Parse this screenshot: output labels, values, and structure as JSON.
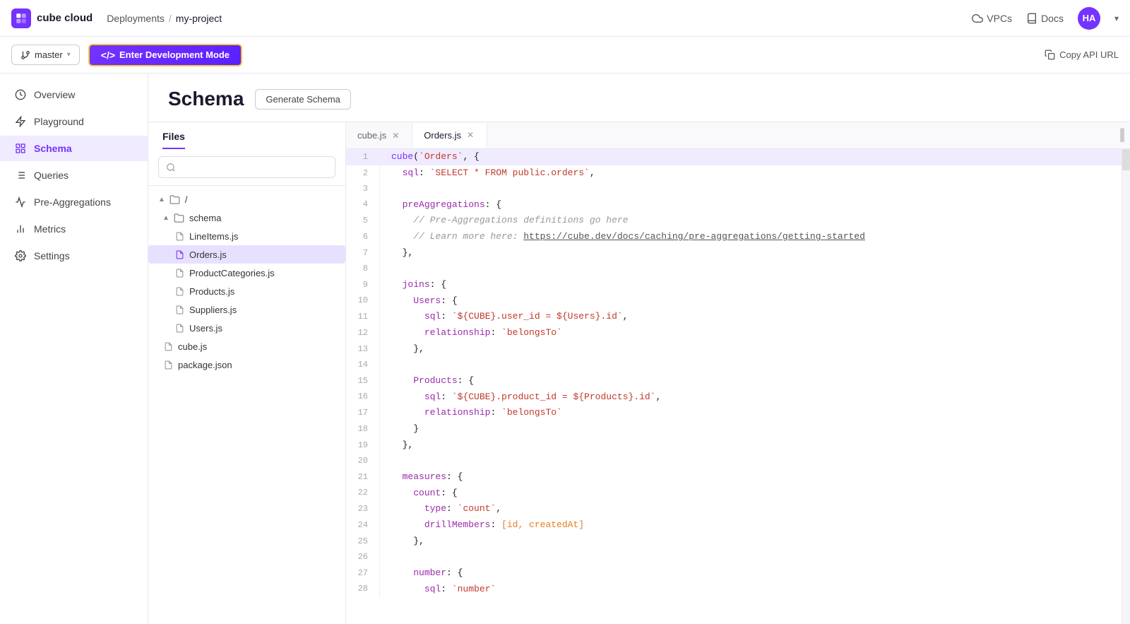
{
  "app": {
    "logo_text": "cube cloud",
    "breadcrumb_root": "Deployments",
    "breadcrumb_sep": "/",
    "breadcrumb_current": "my-project"
  },
  "topnav": {
    "vpcs_label": "VPCs",
    "docs_label": "Docs",
    "avatar_initials": "HA",
    "avatar_chevron": "▾"
  },
  "toolbar": {
    "branch_label": "master",
    "branch_chevron": "▾",
    "dev_mode_label": "Enter Development Mode",
    "copy_api_label": "Copy API URL"
  },
  "sidebar": {
    "items": [
      {
        "id": "overview",
        "label": "Overview"
      },
      {
        "id": "playground",
        "label": "Playground"
      },
      {
        "id": "schema",
        "label": "Schema"
      },
      {
        "id": "queries",
        "label": "Queries"
      },
      {
        "id": "pre-aggregations",
        "label": "Pre-Aggregations"
      },
      {
        "id": "metrics",
        "label": "Metrics"
      },
      {
        "id": "settings",
        "label": "Settings"
      }
    ]
  },
  "content": {
    "page_title": "Schema",
    "generate_schema_btn": "Generate Schema"
  },
  "files_panel": {
    "tab_label": "Files",
    "search_placeholder": "",
    "tree": [
      {
        "id": "root",
        "label": "/",
        "type": "folder",
        "indent": 0,
        "expanded": true,
        "arrow": "▲"
      },
      {
        "id": "schema-folder",
        "label": "schema",
        "type": "folder",
        "indent": 1,
        "expanded": true,
        "arrow": "▲"
      },
      {
        "id": "lineitems",
        "label": "LineItems.js",
        "type": "file",
        "indent": 2,
        "selected": false
      },
      {
        "id": "orders",
        "label": "Orders.js",
        "type": "file",
        "indent": 2,
        "selected": true
      },
      {
        "id": "productcategories",
        "label": "ProductCategories.js",
        "type": "file",
        "indent": 2,
        "selected": false
      },
      {
        "id": "products",
        "label": "Products.js",
        "type": "file",
        "indent": 2,
        "selected": false
      },
      {
        "id": "suppliers",
        "label": "Suppliers.js",
        "type": "file",
        "indent": 2,
        "selected": false
      },
      {
        "id": "users",
        "label": "Users.js",
        "type": "file",
        "indent": 2,
        "selected": false
      },
      {
        "id": "cubejs",
        "label": "cube.js",
        "type": "file",
        "indent": 1,
        "selected": false
      },
      {
        "id": "packagejson",
        "label": "package.json",
        "type": "file",
        "indent": 1,
        "selected": false
      }
    ]
  },
  "editor": {
    "tabs": [
      {
        "id": "cubejs",
        "label": "cube.js",
        "active": false,
        "closeable": true
      },
      {
        "id": "ordersjs",
        "label": "Orders.js",
        "active": true,
        "closeable": true
      }
    ],
    "code_lines": [
      {
        "num": 1,
        "highlighted": true,
        "tokens": [
          {
            "type": "fn",
            "text": "cube"
          },
          {
            "type": "plain",
            "text": "("
          },
          {
            "type": "str",
            "text": "`Orders`"
          },
          {
            "type": "plain",
            "text": ", {"
          }
        ]
      },
      {
        "num": 2,
        "highlighted": false,
        "tokens": [
          {
            "type": "plain",
            "text": "  "
          },
          {
            "type": "key",
            "text": "sql"
          },
          {
            "type": "plain",
            "text": ": "
          },
          {
            "type": "str",
            "text": "`SELECT * FROM public.orders`"
          },
          {
            "type": "plain",
            "text": ","
          }
        ]
      },
      {
        "num": 3,
        "highlighted": false,
        "tokens": []
      },
      {
        "num": 4,
        "highlighted": false,
        "tokens": [
          {
            "type": "plain",
            "text": "  "
          },
          {
            "type": "key",
            "text": "preAggregations"
          },
          {
            "type": "plain",
            "text": ": {"
          }
        ]
      },
      {
        "num": 5,
        "highlighted": false,
        "tokens": [
          {
            "type": "comment",
            "text": "    // Pre-Aggregations definitions go here"
          }
        ]
      },
      {
        "num": 6,
        "highlighted": false,
        "tokens": [
          {
            "type": "comment",
            "text": "    // Learn more here: "
          },
          {
            "type": "link",
            "text": "https://cube.dev/docs/caching/pre-aggregations/getting-started"
          }
        ]
      },
      {
        "num": 7,
        "highlighted": false,
        "tokens": [
          {
            "type": "plain",
            "text": "  },"
          }
        ]
      },
      {
        "num": 8,
        "highlighted": false,
        "tokens": []
      },
      {
        "num": 9,
        "highlighted": false,
        "tokens": [
          {
            "type": "plain",
            "text": "  "
          },
          {
            "type": "key",
            "text": "joins"
          },
          {
            "type": "plain",
            "text": ": {"
          }
        ]
      },
      {
        "num": 10,
        "highlighted": false,
        "tokens": [
          {
            "type": "plain",
            "text": "    "
          },
          {
            "type": "key",
            "text": "Users"
          },
          {
            "type": "plain",
            "text": ": {"
          }
        ]
      },
      {
        "num": 11,
        "highlighted": false,
        "tokens": [
          {
            "type": "plain",
            "text": "      "
          },
          {
            "type": "key",
            "text": "sql"
          },
          {
            "type": "plain",
            "text": ": "
          },
          {
            "type": "str",
            "text": "`${CUBE}.user_id = ${Users}.id`"
          },
          {
            "type": "plain",
            "text": ","
          }
        ]
      },
      {
        "num": 12,
        "highlighted": false,
        "tokens": [
          {
            "type": "plain",
            "text": "      "
          },
          {
            "type": "key",
            "text": "relationship"
          },
          {
            "type": "plain",
            "text": ": "
          },
          {
            "type": "str",
            "text": "`belongsTo`"
          }
        ]
      },
      {
        "num": 13,
        "highlighted": false,
        "tokens": [
          {
            "type": "plain",
            "text": "    },"
          }
        ]
      },
      {
        "num": 14,
        "highlighted": false,
        "tokens": []
      },
      {
        "num": 15,
        "highlighted": false,
        "tokens": [
          {
            "type": "plain",
            "text": "    "
          },
          {
            "type": "key",
            "text": "Products"
          },
          {
            "type": "plain",
            "text": ": {"
          }
        ]
      },
      {
        "num": 16,
        "highlighted": false,
        "tokens": [
          {
            "type": "plain",
            "text": "      "
          },
          {
            "type": "key",
            "text": "sql"
          },
          {
            "type": "plain",
            "text": ": "
          },
          {
            "type": "str",
            "text": "`${CUBE}.product_id = ${Products}.id`"
          },
          {
            "type": "plain",
            "text": ","
          }
        ]
      },
      {
        "num": 17,
        "highlighted": false,
        "tokens": [
          {
            "type": "plain",
            "text": "      "
          },
          {
            "type": "key",
            "text": "relationship"
          },
          {
            "type": "plain",
            "text": ": "
          },
          {
            "type": "str",
            "text": "`belongsTo`"
          }
        ]
      },
      {
        "num": 18,
        "highlighted": false,
        "tokens": [
          {
            "type": "plain",
            "text": "    }"
          }
        ]
      },
      {
        "num": 19,
        "highlighted": false,
        "tokens": [
          {
            "type": "plain",
            "text": "  },"
          }
        ]
      },
      {
        "num": 20,
        "highlighted": false,
        "tokens": []
      },
      {
        "num": 21,
        "highlighted": false,
        "tokens": [
          {
            "type": "plain",
            "text": "  "
          },
          {
            "type": "key",
            "text": "measures"
          },
          {
            "type": "plain",
            "text": ": {"
          }
        ]
      },
      {
        "num": 22,
        "highlighted": false,
        "tokens": [
          {
            "type": "plain",
            "text": "    "
          },
          {
            "type": "key",
            "text": "count"
          },
          {
            "type": "plain",
            "text": ": {"
          }
        ]
      },
      {
        "num": 23,
        "highlighted": false,
        "tokens": [
          {
            "type": "plain",
            "text": "      "
          },
          {
            "type": "key",
            "text": "type"
          },
          {
            "type": "plain",
            "text": ": "
          },
          {
            "type": "str",
            "text": "`count`"
          },
          {
            "type": "plain",
            "text": ","
          }
        ]
      },
      {
        "num": 24,
        "highlighted": false,
        "tokens": [
          {
            "type": "plain",
            "text": "      "
          },
          {
            "type": "key",
            "text": "drillMembers"
          },
          {
            "type": "plain",
            "text": ": "
          },
          {
            "type": "bracket",
            "text": "[id, createdAt]"
          }
        ]
      },
      {
        "num": 25,
        "highlighted": false,
        "tokens": [
          {
            "type": "plain",
            "text": "    },"
          }
        ]
      },
      {
        "num": 26,
        "highlighted": false,
        "tokens": []
      },
      {
        "num": 27,
        "highlighted": false,
        "tokens": [
          {
            "type": "plain",
            "text": "    "
          },
          {
            "type": "key",
            "text": "number"
          },
          {
            "type": "plain",
            "text": ": {"
          }
        ]
      },
      {
        "num": 28,
        "highlighted": false,
        "tokens": [
          {
            "type": "plain",
            "text": "      "
          },
          {
            "type": "key",
            "text": "sql"
          },
          {
            "type": "plain",
            "text": ": "
          },
          {
            "type": "str",
            "text": "`number`"
          }
        ]
      }
    ]
  }
}
